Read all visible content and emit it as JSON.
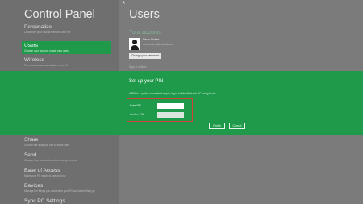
{
  "left_panel": {
    "title": "Control Panel",
    "items": [
      {
        "label": "Personalize",
        "desc": "Customize your lock screen and user tile"
      },
      {
        "label": "Users",
        "desc": "Change your account or add new ones"
      },
      {
        "label": "Wireless",
        "desc": "Turn wireless communication on or off"
      },
      {
        "label": "Share",
        "desc": "Choose the apps you use to share with"
      },
      {
        "label": "Send",
        "desc": "Change how content is sent to nearby devices"
      },
      {
        "label": "Ease of Access",
        "desc": "Make your PC easier to see and use"
      },
      {
        "label": "Devices",
        "desc": "Manage the things you connect to your PC and where they go"
      },
      {
        "label": "Sync PC Settings",
        "desc": ""
      }
    ]
  },
  "users_panel": {
    "title": "Users",
    "your_account": "Your account",
    "account_name": "Devin Nokes",
    "account_email": "devin.nokes@hotmail.com",
    "change_picture": "Change your password",
    "sign_in_options": "Sign-in options"
  },
  "pin_dialog": {
    "title": "Set up your PIN",
    "description": "A PIN is a quick, convenient way to log in to this Windows PC using touch.",
    "enter_pin_label": "Enter PIN",
    "confirm_pin_label": "Confirm PIN",
    "enter_pin_value": "",
    "confirm_pin_value": "",
    "finish_label": "Finish",
    "cancel_label": "Cancel"
  },
  "colors": {
    "accent": "#1f9a4b",
    "highlight_box": "#d24236",
    "background": "#7b7b7b"
  },
  "icons": {
    "avatar": "user-avatar-icon",
    "cursor": "mouse-pointer-icon"
  }
}
